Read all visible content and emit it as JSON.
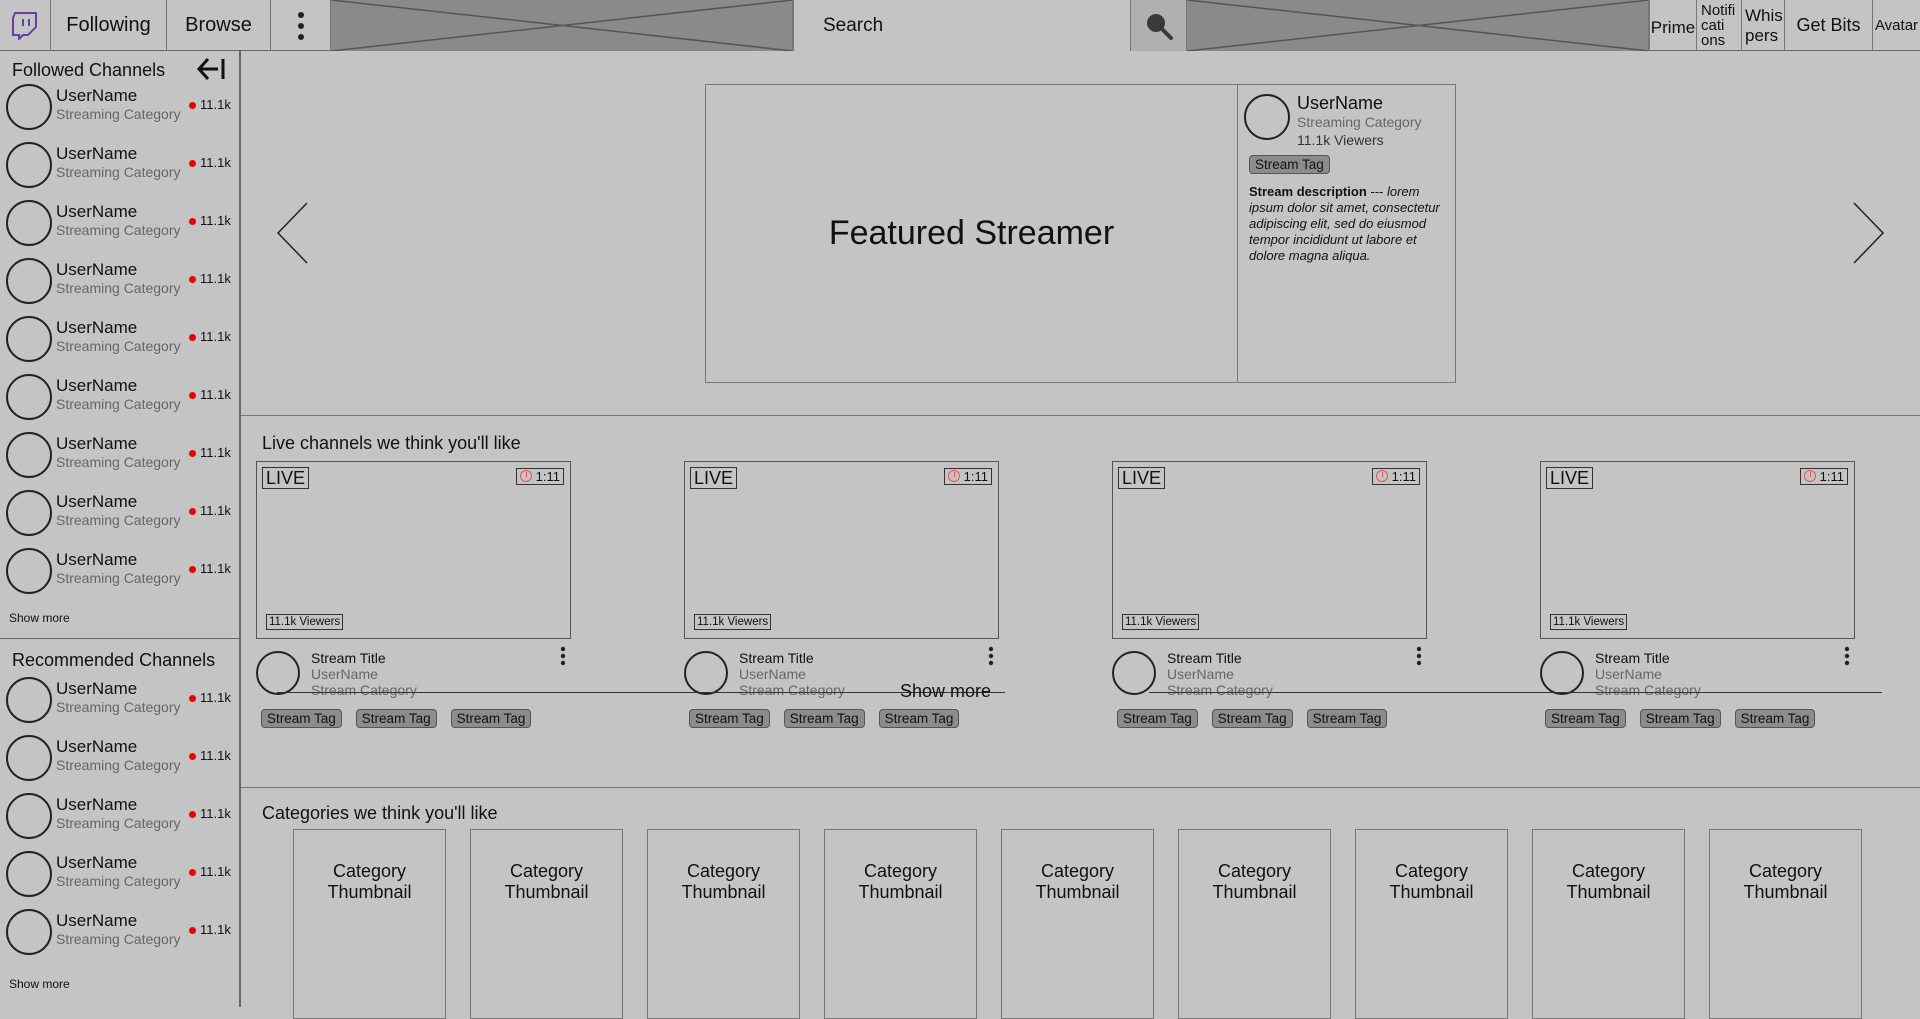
{
  "topbar": {
    "following": "Following",
    "browse": "Browse",
    "search_placeholder": "Search",
    "prime": "Prime",
    "notifications": "Notifi cati ons",
    "whispers": "Whis pers",
    "get_bits": "Get Bits",
    "avatar": "Avatar"
  },
  "sidebar": {
    "followed_title": "Followed Channels",
    "followed": [
      {
        "name": "UserName",
        "category": "Streaming Category",
        "viewers": "11.1k"
      },
      {
        "name": "UserName",
        "category": "Streaming Category",
        "viewers": "11.1k"
      },
      {
        "name": "UserName",
        "category": "Streaming Category",
        "viewers": "11.1k"
      },
      {
        "name": "UserName",
        "category": "Streaming Category",
        "viewers": "11.1k"
      },
      {
        "name": "UserName",
        "category": "Streaming Category",
        "viewers": "11.1k"
      },
      {
        "name": "UserName",
        "category": "Streaming Category",
        "viewers": "11.1k"
      },
      {
        "name": "UserName",
        "category": "Streaming Category",
        "viewers": "11.1k"
      },
      {
        "name": "UserName",
        "category": "Streaming Category",
        "viewers": "11.1k"
      },
      {
        "name": "UserName",
        "category": "Streaming Category",
        "viewers": "11.1k"
      }
    ],
    "followed_show_more": "Show more",
    "recommended_title": "Recommended Channels",
    "recommended": [
      {
        "name": "UserName",
        "category": "Streaming Category",
        "viewers": "11.1k"
      },
      {
        "name": "UserName",
        "category": "Streaming Category",
        "viewers": "11.1k"
      },
      {
        "name": "UserName",
        "category": "Streaming Category",
        "viewers": "11.1k"
      },
      {
        "name": "UserName",
        "category": "Streaming Category",
        "viewers": "11.1k"
      },
      {
        "name": "UserName",
        "category": "Streaming Category",
        "viewers": "11.1k"
      }
    ],
    "recommended_show_more": "Show more"
  },
  "featured": {
    "label": "Featured Streamer",
    "username": "UserName",
    "category": "Streaming Category",
    "viewers": "11.1k Viewers",
    "tag": "Stream Tag",
    "desc_bold": "Stream description",
    "desc_sep": " --- ",
    "desc_text": "lorem ipsum dolor sit amet, consectetur adipiscing elit, sed do eiusmod tempor incididunt ut labore et dolore magna aliqua."
  },
  "live": {
    "title": "Live channels we think you'll like",
    "cards": [
      {
        "live": "LIVE",
        "time": "1:11",
        "viewers": "11.1k Viewers",
        "title": "Stream Title",
        "user": "UserName",
        "category": "Stream Category",
        "tags": [
          "Stream Tag",
          "Stream Tag",
          "Stream Tag"
        ]
      },
      {
        "live": "LIVE",
        "time": "1:11",
        "viewers": "11.1k Viewers",
        "title": "Stream Title",
        "user": "UserName",
        "category": "Stream Category",
        "tags": [
          "Stream Tag",
          "Stream Tag",
          "Stream Tag"
        ]
      },
      {
        "live": "LIVE",
        "time": "1:11",
        "viewers": "11.1k Viewers",
        "title": "Stream Title",
        "user": "UserName",
        "category": "Stream Category",
        "tags": [
          "Stream Tag",
          "Stream Tag",
          "Stream Tag"
        ]
      },
      {
        "live": "LIVE",
        "time": "1:11",
        "viewers": "11.1k Viewers",
        "title": "Stream Title",
        "user": "UserName",
        "category": "Stream Category",
        "tags": [
          "Stream Tag",
          "Stream Tag",
          "Stream Tag"
        ]
      }
    ],
    "show_more": "Show more"
  },
  "categories": {
    "title": "Categories we think you'll like",
    "items": [
      {
        "line1": "Category",
        "line2": "Thumbnail"
      },
      {
        "line1": "Category",
        "line2": "Thumbnail"
      },
      {
        "line1": "Category",
        "line2": "Thumbnail"
      },
      {
        "line1": "Category",
        "line2": "Thumbnail"
      },
      {
        "line1": "Category",
        "line2": "Thumbnail"
      },
      {
        "line1": "Category",
        "line2": "Thumbnail"
      },
      {
        "line1": "Category",
        "line2": "Thumbnail"
      },
      {
        "line1": "Category",
        "line2": "Thumbnail"
      },
      {
        "line1": "Category",
        "line2": "Thumbnail"
      }
    ]
  },
  "colors": {
    "background": "#c4c4c4",
    "logo": "#6441a5",
    "live_dot": "#e00000",
    "tag": "#8c8c8c"
  }
}
